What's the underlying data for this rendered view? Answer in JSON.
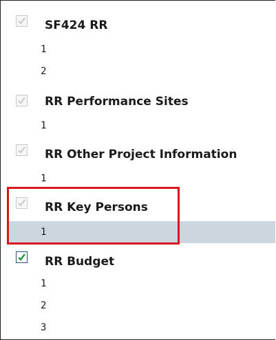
{
  "forms": [
    {
      "title": "SF424 RR",
      "checked": true,
      "enabled": false,
      "pages": [
        "1",
        "2"
      ]
    },
    {
      "title": "RR Performance Sites",
      "checked": true,
      "enabled": false,
      "pages": [
        "1"
      ]
    },
    {
      "title": "RR Other Project Information",
      "checked": true,
      "enabled": false,
      "pages": [
        "1"
      ]
    },
    {
      "title": "RR Key Persons",
      "checked": true,
      "enabled": false,
      "pages": [
        "1"
      ],
      "highlighted": true
    },
    {
      "title": "RR Budget",
      "checked": true,
      "enabled": true,
      "pages": [
        "1",
        "2",
        "3"
      ]
    }
  ],
  "colors": {
    "disabled_check": "#c8c8c8",
    "active_check": "#1a9a3a",
    "highlight": "#ccd6de",
    "callout_border": "#d9161d"
  }
}
